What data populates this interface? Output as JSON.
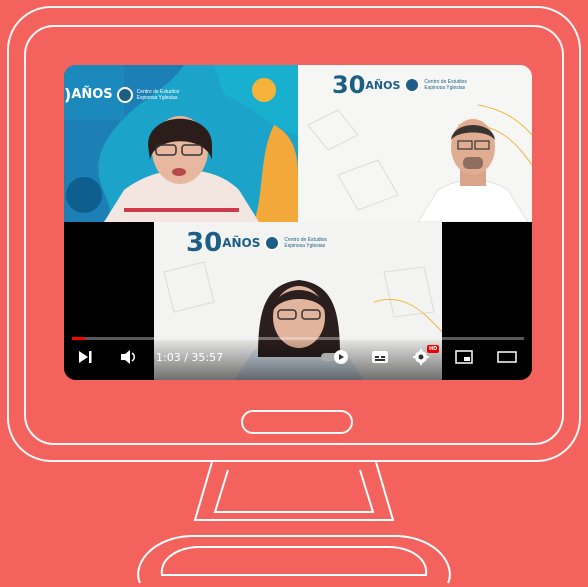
{
  "colors": {
    "background": "#f4625e",
    "outline": "#ffffff",
    "progress": "#ff0000",
    "brand": "#1c5e86"
  },
  "logo": {
    "years_number": "30",
    "years_word": "AÑOS",
    "org_line1": "Centro de Estudios",
    "org_line2": "Espinosa Yglesias"
  },
  "player": {
    "time": "1:03 / 35:57",
    "progress_fraction": 0.029,
    "hd_badge": "HD",
    "icons": [
      "next-icon",
      "volume-icon",
      "autoplay-toggle-icon",
      "subtitles-icon",
      "settings-icon",
      "miniplayer-icon",
      "theater-mode-icon"
    ]
  }
}
